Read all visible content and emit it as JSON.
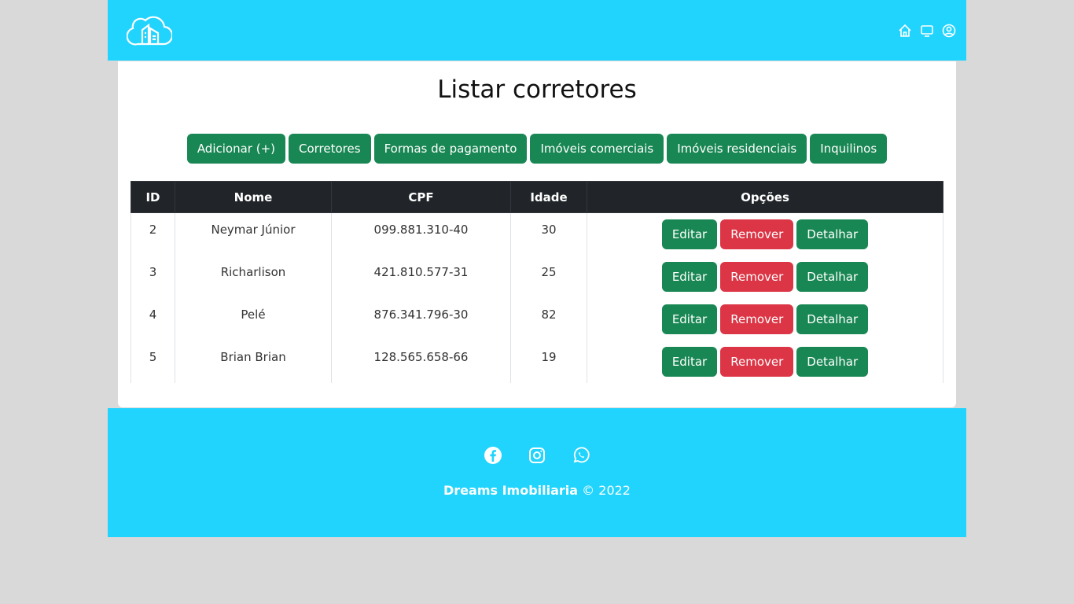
{
  "header": {
    "icons": [
      "house-icon",
      "monitor-icon",
      "user-circle-icon"
    ]
  },
  "page": {
    "title": "Listar corretores"
  },
  "actions": [
    "Adicionar (+)",
    "Corretores",
    "Formas de pagamento",
    "Imóveis comerciais",
    "Imóveis residenciais",
    "Inquilinos"
  ],
  "table": {
    "headers": [
      "ID",
      "Nome",
      "CPF",
      "Idade",
      "Opções"
    ],
    "rows": [
      {
        "id": "2",
        "nome": "Neymar Júnior",
        "cpf": "099.881.310-40",
        "idade": "30"
      },
      {
        "id": "3",
        "nome": "Richarlison",
        "cpf": "421.810.577-31",
        "idade": "25"
      },
      {
        "id": "4",
        "nome": "Pelé",
        "cpf": "876.341.796-30",
        "idade": "82"
      },
      {
        "id": "5",
        "nome": "Brian Brian",
        "cpf": "128.565.658-66",
        "idade": "19"
      }
    ],
    "row_actions": {
      "edit": "Editar",
      "remove": "Remover",
      "detail": "Detalhar"
    }
  },
  "footer": {
    "brand": "Dreams Imobiliaria",
    "copy": "© 2022",
    "social": [
      "facebook-icon",
      "instagram-icon",
      "whatsapp-icon"
    ]
  },
  "colors": {
    "accent": "#21d4fd",
    "green": "#198754",
    "red": "#dc3545",
    "dark": "#212529"
  }
}
